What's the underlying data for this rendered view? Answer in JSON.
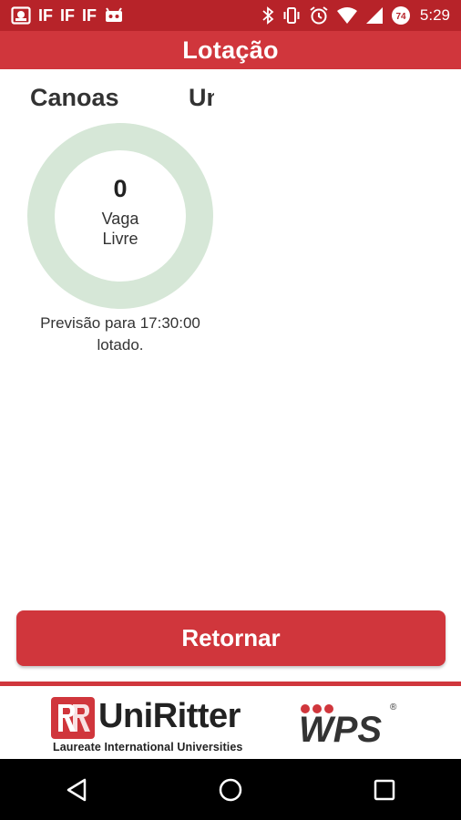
{
  "status_bar": {
    "time": "5:29",
    "badge": "74",
    "left_icons": [
      "picture-icon",
      "if-icon",
      "if-icon",
      "if-icon",
      "android-icon"
    ],
    "right_icons": [
      "bluetooth-icon",
      "vibrate-icon",
      "alarm-icon",
      "wifi-icon",
      "signal-icon"
    ],
    "if_label": "IF"
  },
  "app_bar": {
    "title": "Lotação"
  },
  "tabs": [
    {
      "label": "Canoas",
      "active": true
    },
    {
      "label": "Uni",
      "active": false
    }
  ],
  "occupancy": {
    "count": "0",
    "label_line1": "Vaga",
    "label_line2": "Livre",
    "ring_color": "#d6e7d7"
  },
  "forecast": {
    "line1": "Previsão para 17:30:00",
    "line2": "lotado."
  },
  "actions": {
    "return_label": "Retornar"
  },
  "footer": {
    "brand_name": "UniRitter",
    "brand_tagline": "Laureate International Universities",
    "partner_logo": "WPS",
    "registered_mark": "®"
  },
  "nav_bar": {
    "buttons": [
      "back-icon",
      "home-icon",
      "recents-icon"
    ]
  },
  "colors": {
    "status_bar": "#b72329",
    "accent": "#d0363c",
    "ring": "#d6e7d7"
  }
}
